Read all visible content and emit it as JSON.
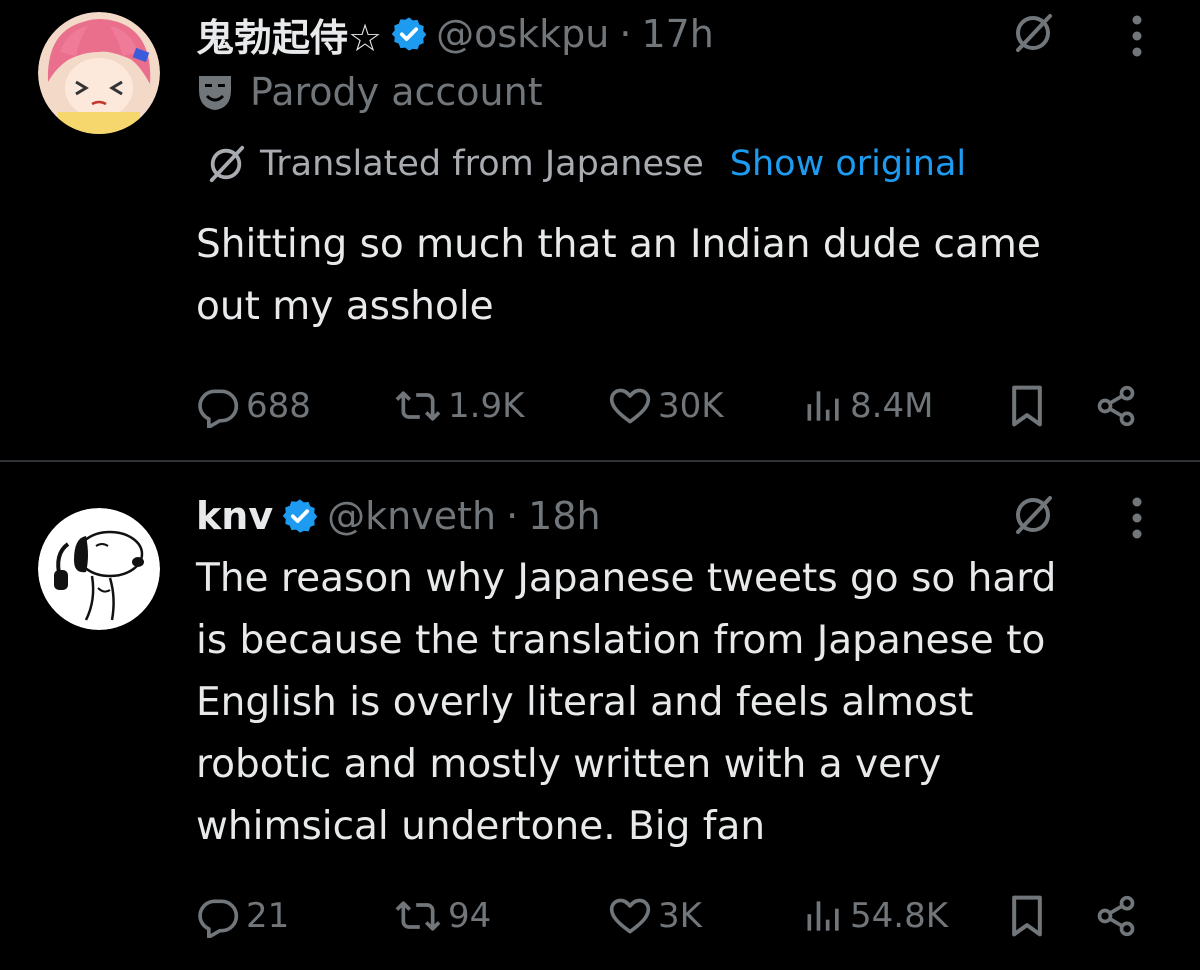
{
  "tweets": [
    {
      "display_name": "鬼勃起侍☆",
      "handle": "@oskkpu",
      "separator": "·",
      "time": "17h",
      "parody_label": "Parody account",
      "translation": {
        "label": "Translated from Japanese",
        "show_original": "Show original"
      },
      "text_lines": [
        "Shitting so much that an Indian dude came",
        "out my asshole"
      ],
      "stats": {
        "replies": "688",
        "reposts": "1.9K",
        "likes": "30K",
        "views": "8.4M"
      }
    },
    {
      "display_name": "knv",
      "handle": "@knveth",
      "separator": "·",
      "time": "18h",
      "text_lines": [
        "The reason why Japanese tweets go so hard",
        "is because the translation from Japanese to",
        "English is overly literal and feels almost",
        "robotic and mostly written with a very",
        "whimsical undertone. Big fan"
      ],
      "stats": {
        "replies": "21",
        "reposts": "94",
        "likes": "3K",
        "views": "54.8K"
      }
    }
  ],
  "colors": {
    "background": "#000000",
    "text": "#e7e9ea",
    "secondary": "#71767b",
    "link": "#1d9bf0",
    "verified": "#1d9bf0",
    "divider": "#2f3336"
  },
  "icons": {
    "verified": "verified-badge-icon",
    "grok": "grok-icon",
    "more": "more-dots-icon",
    "parody": "parody-mask-icon",
    "reply": "reply-icon",
    "repost": "repost-icon",
    "like": "like-icon",
    "views": "views-icon",
    "bookmark": "bookmark-icon",
    "share": "share-icon"
  }
}
